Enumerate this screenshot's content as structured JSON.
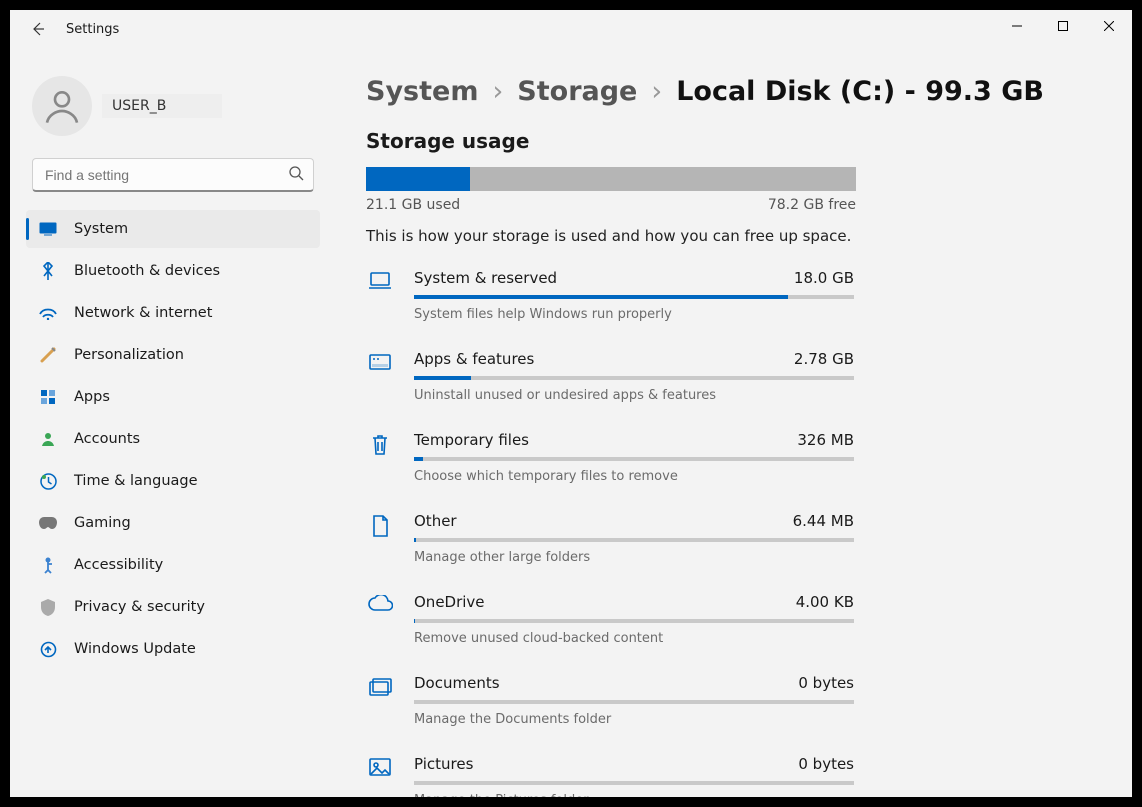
{
  "app_title": "Settings",
  "user": {
    "name": "USER_B"
  },
  "search": {
    "placeholder": "Find a setting"
  },
  "sidebar": {
    "items": [
      {
        "label": "System",
        "active": true
      },
      {
        "label": "Bluetooth & devices"
      },
      {
        "label": "Network & internet"
      },
      {
        "label": "Personalization"
      },
      {
        "label": "Apps"
      },
      {
        "label": "Accounts"
      },
      {
        "label": "Time & language"
      },
      {
        "label": "Gaming"
      },
      {
        "label": "Accessibility"
      },
      {
        "label": "Privacy & security"
      },
      {
        "label": "Windows Update"
      }
    ]
  },
  "breadcrumb": {
    "a": "System",
    "b": "Storage",
    "current": "Local Disk (C:) - 99.3 GB"
  },
  "usage": {
    "title": "Storage usage",
    "used_label": "21.1 GB used",
    "free_label": "78.2 GB free",
    "percent": 21.25,
    "description": "This is how your storage is used and how you can free up space."
  },
  "categories": [
    {
      "name": "System & reserved",
      "size": "18.0 GB",
      "sub": "System files help Windows run properly",
      "pct": 85,
      "icon": "laptop"
    },
    {
      "name": "Apps & features",
      "size": "2.78 GB",
      "sub": "Uninstall unused or undesired apps & features",
      "pct": 13,
      "icon": "apps"
    },
    {
      "name": "Temporary files",
      "size": "326 MB",
      "sub": "Choose which temporary files to remove",
      "pct": 2,
      "icon": "trash"
    },
    {
      "name": "Other",
      "size": "6.44 MB",
      "sub": "Manage other large folders",
      "pct": 0.5,
      "icon": "other"
    },
    {
      "name": "OneDrive",
      "size": "4.00 KB",
      "sub": "Remove unused cloud-backed content",
      "pct": 0.2,
      "icon": "cloud"
    },
    {
      "name": "Documents",
      "size": "0 bytes",
      "sub": "Manage the Documents folder",
      "pct": 0,
      "icon": "documents"
    },
    {
      "name": "Pictures",
      "size": "0 bytes",
      "sub": "Manage the Pictures folder",
      "pct": 0,
      "icon": "pictures"
    }
  ]
}
